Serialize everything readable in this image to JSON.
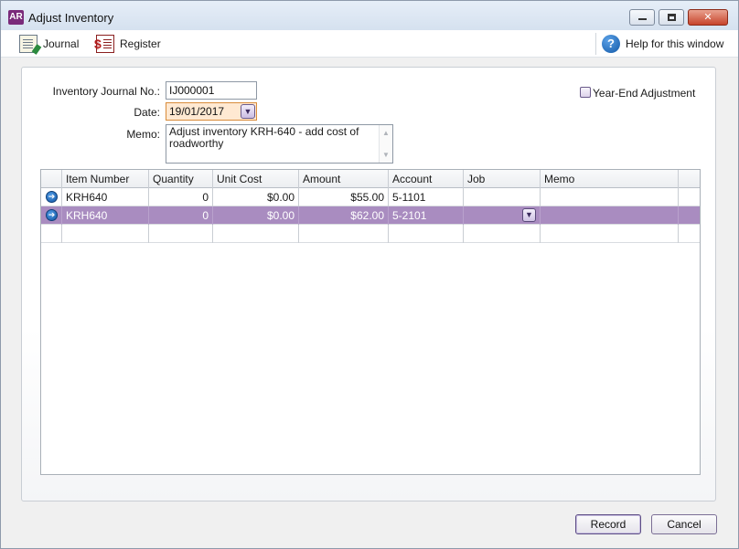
{
  "window": {
    "app_badge": "AR",
    "title": "Adjust Inventory",
    "controls": {
      "minimize": "",
      "maximize": "",
      "close": "✕"
    }
  },
  "toolbar": {
    "journal_label": "Journal",
    "register_label": "Register",
    "help_label": "Help for this window"
  },
  "form": {
    "journal_no_label": "Inventory Journal No.:",
    "journal_no_value": "IJ000001",
    "date_label": "Date:",
    "date_value": "19/01/2017",
    "memo_label": "Memo:",
    "memo_value": "Adjust inventory KRH-640 - add cost of roadworthy",
    "year_end_label": "Year-End Adjustment",
    "year_end_checked": false
  },
  "grid": {
    "columns": [
      "Item Number",
      "Quantity",
      "Unit Cost",
      "Amount",
      "Account",
      "Job",
      "Memo"
    ],
    "rows": [
      {
        "item": "KRH640",
        "quantity": "0",
        "unit_cost": "$0.00",
        "amount": "$55.00",
        "account": "5-1101",
        "job": "",
        "memo": "",
        "selected": false
      },
      {
        "item": "KRH640",
        "quantity": "0",
        "unit_cost": "$0.00",
        "amount": "$62.00",
        "account": "5-2101",
        "job": "",
        "memo": "",
        "selected": true
      }
    ]
  },
  "buttons": {
    "record": "Record",
    "cancel": "Cancel"
  },
  "colors": {
    "selected_row": "#a98cc0",
    "date_field_bg": "#ffe9d2",
    "app_badge": "#7a2a7a"
  }
}
